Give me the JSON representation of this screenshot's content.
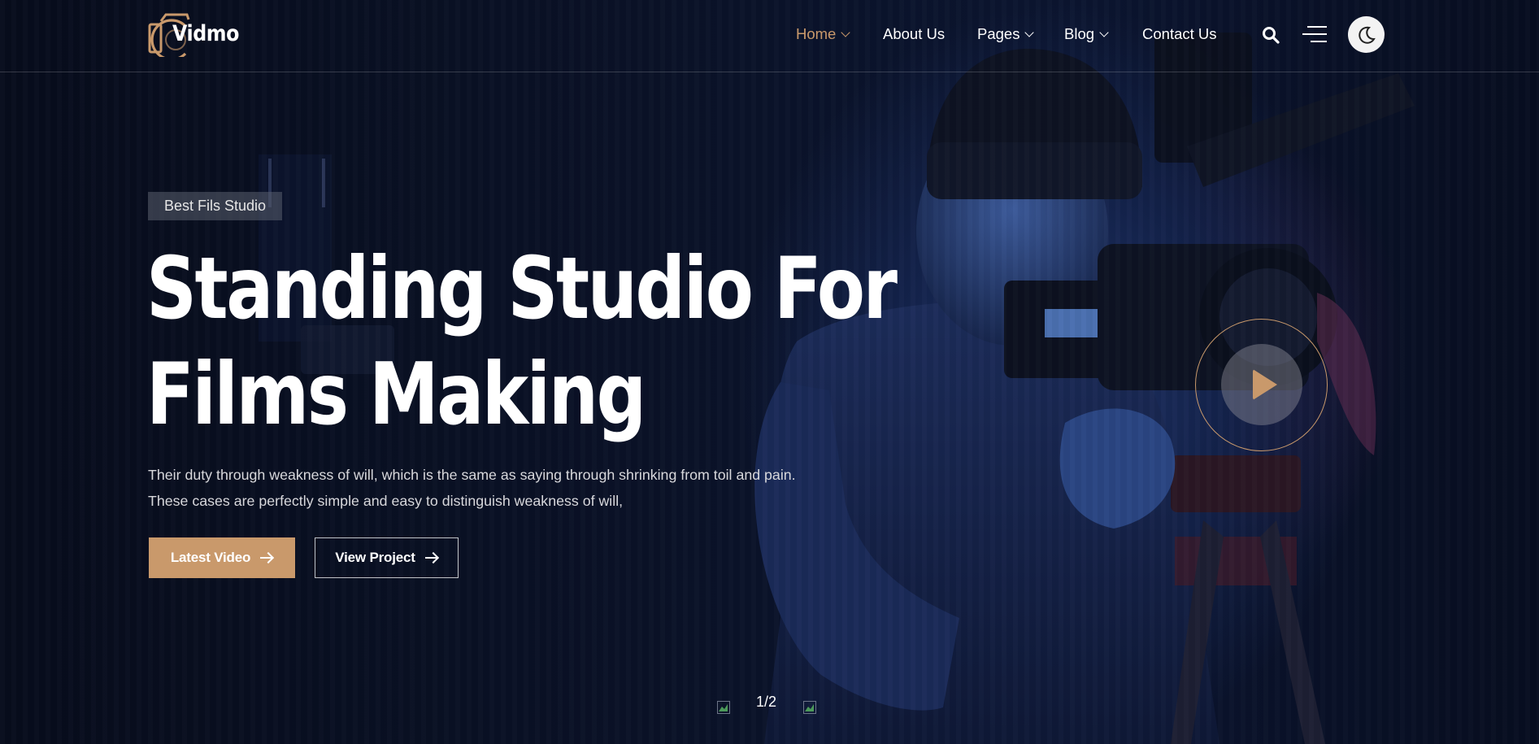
{
  "brand": {
    "name": "Vidmo",
    "accent": "#c9996b"
  },
  "nav": {
    "items": [
      {
        "label": "Home",
        "active": true,
        "has_dropdown": true
      },
      {
        "label": "About Us",
        "active": false,
        "has_dropdown": false
      },
      {
        "label": "Pages",
        "active": false,
        "has_dropdown": true
      },
      {
        "label": "Blog",
        "active": false,
        "has_dropdown": true
      },
      {
        "label": "Contact Us",
        "active": false,
        "has_dropdown": false
      }
    ],
    "icons": [
      "search-icon",
      "menu-icon",
      "moon-icon"
    ]
  },
  "hero": {
    "badge": "Best Fils Studio",
    "title_line1": "Standing Studio For",
    "title_line2": "Films Making",
    "desc_line1": "Their duty through weakness of will, which is the same as saying through shrinking from toil and pain.",
    "desc_line2": "These cases are perfectly simple and easy to distinguish weakness of will,",
    "primary_button": "Latest Video",
    "secondary_button": "View Project",
    "play_icon": "play-icon"
  },
  "slider": {
    "counter": "1/2",
    "prev_icon": "prev-arrow-icon",
    "next_icon": "next-arrow-icon"
  }
}
